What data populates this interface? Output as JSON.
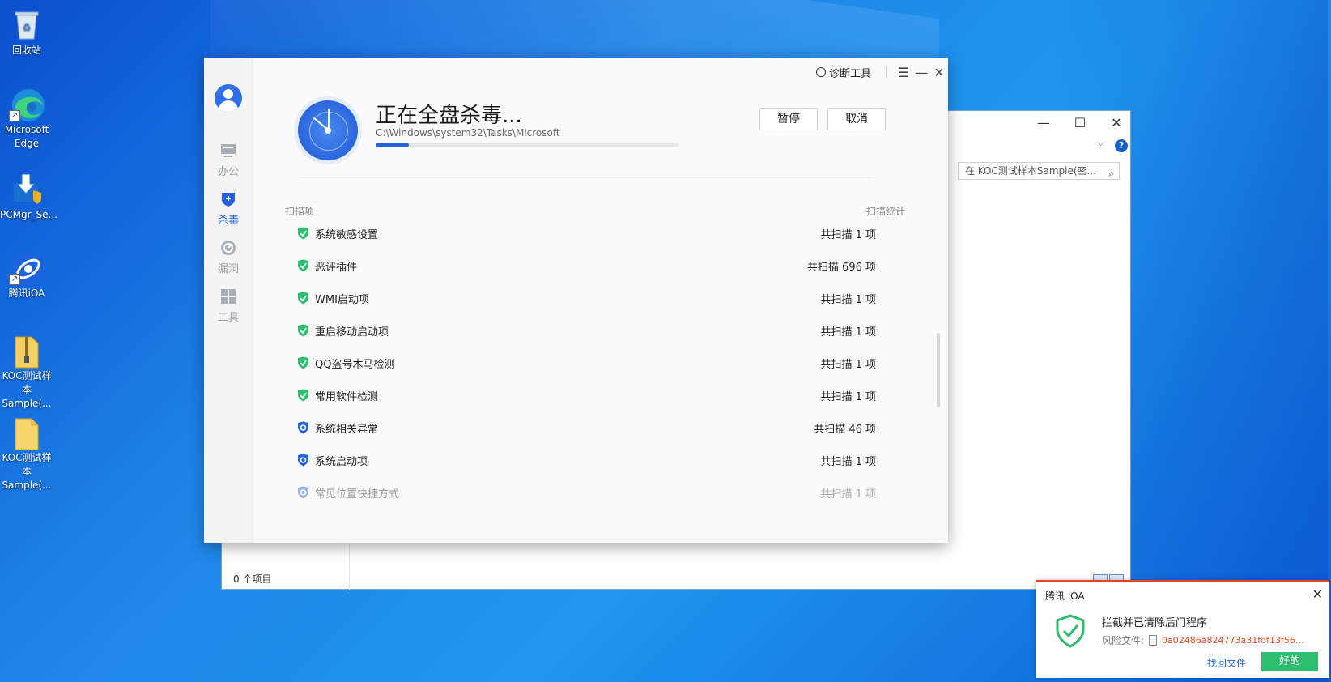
{
  "desktop": {
    "icons": [
      {
        "label_lines": [
          "回收站"
        ],
        "icon": "recycle-bin-icon"
      },
      {
        "label_lines": [
          "Microsoft",
          "Edge"
        ],
        "icon": "edge-icon"
      },
      {
        "label_lines": [
          "PCMgr_Se..."
        ],
        "icon": "installer-icon"
      },
      {
        "label_lines": [
          "腾讯iOA"
        ],
        "icon": "ioa-icon"
      },
      {
        "label_lines": [
          "KOC测试样",
          "本Sample(..."
        ],
        "icon": "zip-folder-icon"
      },
      {
        "label_lines": [
          "KOC测试样",
          "本Sample(..."
        ],
        "icon": "folder-icon"
      }
    ]
  },
  "explorer": {
    "search_placeholder": "在 KOC测试样本Sample(密...",
    "status": "0 个项目",
    "help": "?"
  },
  "av": {
    "topbar": {
      "diag_label": "诊断工具",
      "menu": "☰",
      "minimize": "—",
      "close": "✕"
    },
    "nav": [
      {
        "label": "办公",
        "icon": "office-icon",
        "active": false
      },
      {
        "label": "杀毒",
        "icon": "antivirus-shield-icon",
        "active": true
      },
      {
        "label": "漏洞",
        "icon": "vulnerability-icon",
        "active": false
      },
      {
        "label": "工具",
        "icon": "tools-grid-icon",
        "active": false
      }
    ],
    "scan": {
      "title": "正在全盘杀毒...",
      "path": "C:\\Windows\\system32\\Tasks\\Microsoft",
      "progress": 0.11,
      "pause_label": "暂停",
      "cancel_label": "取消"
    },
    "columns": {
      "item": "扫描项",
      "stats": "扫描统计"
    },
    "rows": [
      {
        "name": "系统敏感设置",
        "stat": "共扫描 1 项",
        "status": "done"
      },
      {
        "name": "恶评插件",
        "stat": "共扫描 696 项",
        "status": "done"
      },
      {
        "name": "WMI启动项",
        "stat": "共扫描 1 项",
        "status": "done"
      },
      {
        "name": "重启移动启动项",
        "stat": "共扫描 1 项",
        "status": "done"
      },
      {
        "name": "QQ盗号木马检测",
        "stat": "共扫描 1 项",
        "status": "done"
      },
      {
        "name": "常用软件检测",
        "stat": "共扫描 1 项",
        "status": "done"
      },
      {
        "name": "系统相关异常",
        "stat": "共扫描 46 项",
        "status": "scanning"
      },
      {
        "name": "系统启动项",
        "stat": "共扫描 1 项",
        "status": "scanning"
      },
      {
        "name": "常见位置快捷方式",
        "stat": "共扫描 1 项",
        "status": "pending"
      }
    ],
    "colors": {
      "accent": "#2463e0",
      "done": "#2dbd6e",
      "scanning": "#2463e0"
    }
  },
  "notification": {
    "app": "腾讯 iOA",
    "message": "拦截并已清除后门程序",
    "risk_label": "风险文件:",
    "risk_file": "0a02486a824773a31fdf13f567d...",
    "find_label": "找回文件",
    "ok_label": "好的",
    "close": "✕",
    "colors": {
      "risk": "#e0471f",
      "ok": "#2dbd6e"
    }
  }
}
